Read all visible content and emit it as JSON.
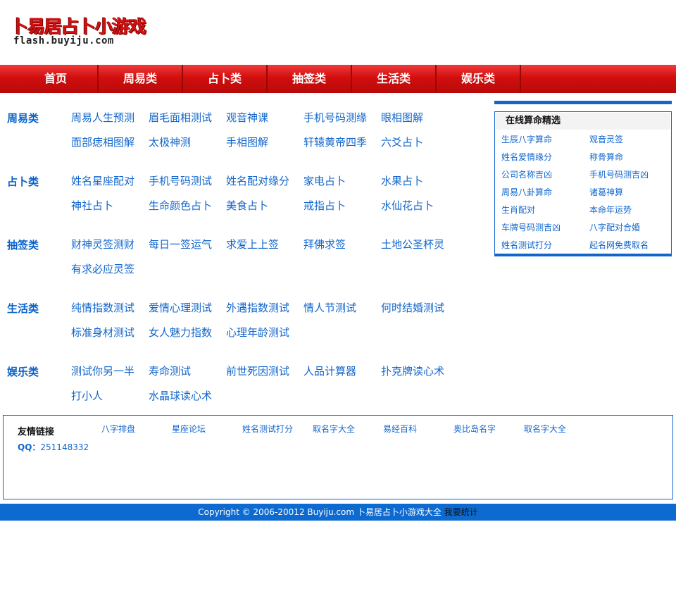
{
  "logo": {
    "title_cn": "卜易居占卜小游戏",
    "domain": "flash.buyiju.com"
  },
  "nav": [
    "首页",
    "周易类",
    "占卜类",
    "抽签类",
    "生活类",
    "娱乐类"
  ],
  "categories": [
    {
      "title": "周易类",
      "links": [
        "周易人生预测",
        "眉毛面相测试",
        "观音神课",
        "手机号码测缘",
        "眼相图解",
        "面部痣相图解",
        "太极神测",
        "手相图解",
        "轩辕黄帝四季",
        "六爻占卜"
      ]
    },
    {
      "title": "占卜类",
      "links": [
        "姓名星座配对",
        "手机号码测试",
        "姓名配对缘分",
        "家电占卜",
        "水果占卜",
        "神社占卜",
        "生命颜色占卜",
        "美食占卜",
        "戒指占卜",
        "水仙花占卜"
      ]
    },
    {
      "title": "抽签类",
      "links": [
        "财神灵签测财",
        "每日一签运气",
        "求爱上上签",
        "拜佛求签",
        "土地公圣杯灵",
        "有求必应灵签"
      ]
    },
    {
      "title": "生活类",
      "links": [
        "纯情指数测试",
        "爱情心理测试",
        "外遇指数测试",
        "情人节测试",
        "何时结婚测试",
        "标准身材测试",
        "女人魅力指数",
        "心理年龄测试"
      ]
    },
    {
      "title": "娱乐类",
      "links": [
        "测试你另一半",
        "寿命测试",
        "前世死因测试",
        "人品计算器",
        "扑克牌读心术",
        "打小人",
        "水晶球读心术"
      ]
    }
  ],
  "sidebar": {
    "title": "在线算命精选",
    "links": [
      "生辰八字算命",
      "观音灵签",
      "姓名爱情缘分",
      "称骨算命",
      "公司名称吉凶",
      "手机号码测吉凶",
      "周易八卦算命",
      "诸葛神算",
      "生肖配对",
      "本命年运势",
      "车牌号码测吉凶",
      "八字配对合婚",
      "姓名测试打分",
      "起名网免费取名"
    ]
  },
  "friends": {
    "title": "友情链接",
    "links": [
      "八字排盘",
      "星座论坛",
      "姓名测试打分",
      "取名字大全",
      "易经百科",
      "奥比岛名字",
      "取名字大全"
    ],
    "qq_label": "QQ：",
    "qq_number": "251148332"
  },
  "footer": {
    "copyright": "Copyright © 2006-20012 Buyiju.com",
    "site_link": "卜易居占卜小游戏大全",
    "stat_link": "我要统计"
  }
}
